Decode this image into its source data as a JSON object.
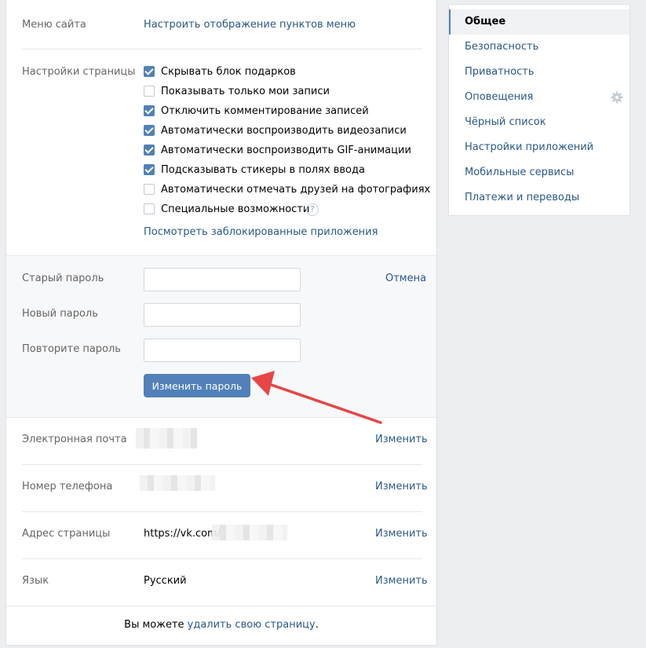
{
  "menu": {
    "label": "Меню сайта",
    "link": "Настроить отображение пунктов меню"
  },
  "page_settings": {
    "label": "Настройки страницы",
    "options": [
      {
        "label": "Скрывать блок подарков",
        "checked": true
      },
      {
        "label": "Показывать только мои записи",
        "checked": false
      },
      {
        "label": "Отключить комментирование записей",
        "checked": true
      },
      {
        "label": "Автоматически воспроизводить видеозаписи",
        "checked": true
      },
      {
        "label": "Автоматически воспроизводить GIF-анимации",
        "checked": true
      },
      {
        "label": "Подсказывать стикеры в полях ввода",
        "checked": true
      },
      {
        "label": "Автоматически отмечать друзей на фотографиях",
        "checked": false
      },
      {
        "label": "Специальные возможности",
        "checked": false
      }
    ],
    "help_glyph": "?",
    "blocked_apps_link": "Посмотреть заблокированные приложения"
  },
  "password": {
    "old_label": "Старый пароль",
    "new_label": "Новый пароль",
    "repeat_label": "Повторите пароль",
    "cancel": "Отмена",
    "submit": "Изменить пароль"
  },
  "email": {
    "label": "Электронная почта",
    "change": "Изменить"
  },
  "phone": {
    "label": "Номер телефона",
    "change": "Изменить"
  },
  "address": {
    "label": "Адрес страницы",
    "value_prefix": "https://vk.com/",
    "change": "Изменить"
  },
  "language": {
    "label": "Язык",
    "value": "Русский",
    "change": "Изменить"
  },
  "footer": {
    "text": "Вы можете ",
    "link": "удалить свою страницу",
    "end": "."
  },
  "sidebar": {
    "items": [
      {
        "label": "Общее",
        "active": true
      },
      {
        "label": "Безопасность",
        "active": false
      },
      {
        "label": "Приватность",
        "active": false
      },
      {
        "label": "Оповещения",
        "active": false
      },
      {
        "label": "Чёрный список",
        "active": false
      },
      {
        "label": "Настройки приложений",
        "active": false
      },
      {
        "label": "Мобильные сервисы",
        "active": false
      },
      {
        "label": "Платежи и переводы",
        "active": false
      }
    ]
  },
  "colors": {
    "accent": "#5181b8",
    "link": "#2a5885",
    "arrow": "#e64646"
  },
  "icons": {
    "sidebar_gear": "gear-icon",
    "annotation": "red-arrow-icon"
  }
}
